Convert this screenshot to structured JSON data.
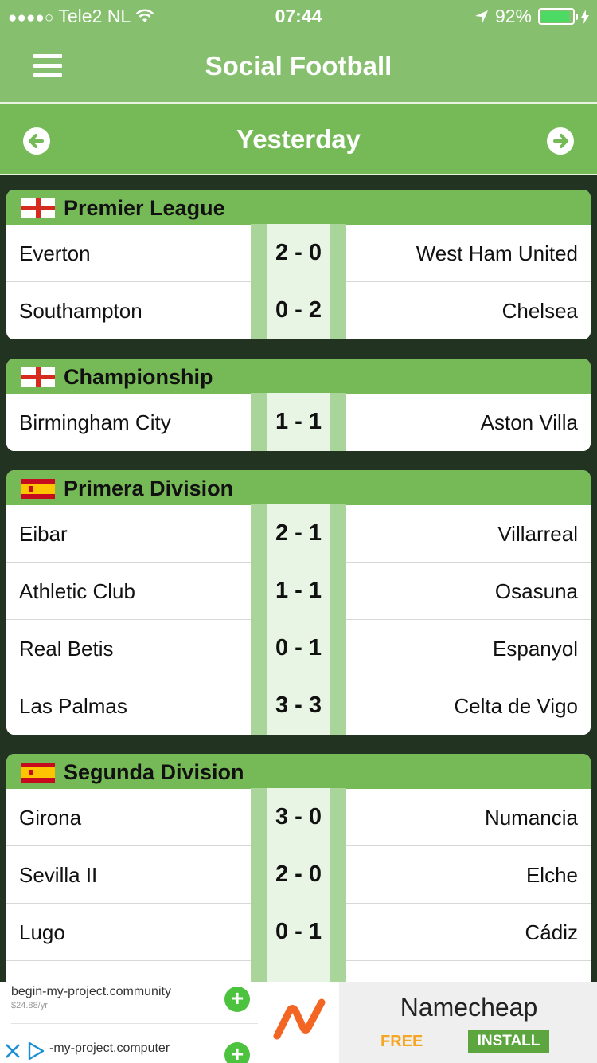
{
  "status": {
    "signal": "●●●●○",
    "carrier": "Tele2 NL",
    "time": "07:44",
    "battery": "92%",
    "battery_level": 0.92
  },
  "nav": {
    "title": "Social Football"
  },
  "date_nav": {
    "title": "Yesterday"
  },
  "leagues": [
    {
      "name": "Premier League",
      "flag": "england-flag",
      "matches": [
        {
          "home": "Everton",
          "score": "2 - 0",
          "away": "West Ham United"
        },
        {
          "home": "Southampton",
          "score": "0 - 2",
          "away": "Chelsea"
        }
      ]
    },
    {
      "name": "Championship",
      "flag": "england-flag",
      "matches": [
        {
          "home": "Birmingham City",
          "score": "1 - 1",
          "away": "Aston Villa"
        }
      ]
    },
    {
      "name": "Primera Division",
      "flag": "spain-flag",
      "matches": [
        {
          "home": "Eibar",
          "score": "2 - 1",
          "away": "Villarreal"
        },
        {
          "home": "Athletic Club",
          "score": "1 - 1",
          "away": "Osasuna"
        },
        {
          "home": "Real Betis",
          "score": "0 - 1",
          "away": "Espanyol"
        },
        {
          "home": "Las Palmas",
          "score": "3 - 3",
          "away": "Celta de Vigo"
        }
      ]
    },
    {
      "name": "Segunda Division",
      "flag": "spain-flag",
      "matches": [
        {
          "home": "Girona",
          "score": "3 - 0",
          "away": "Numancia"
        },
        {
          "home": "Sevilla II",
          "score": "2 - 0",
          "away": "Elche"
        },
        {
          "home": "Lugo",
          "score": "0 - 1",
          "away": "Cádiz"
        }
      ]
    }
  ],
  "ad": {
    "item1": "begin-my-project.community",
    "item1_price": "$24.88/yr",
    "item2": "-my-project.computer",
    "brand": "Namecheap",
    "free": "FREE",
    "install": "INSTALL"
  }
}
